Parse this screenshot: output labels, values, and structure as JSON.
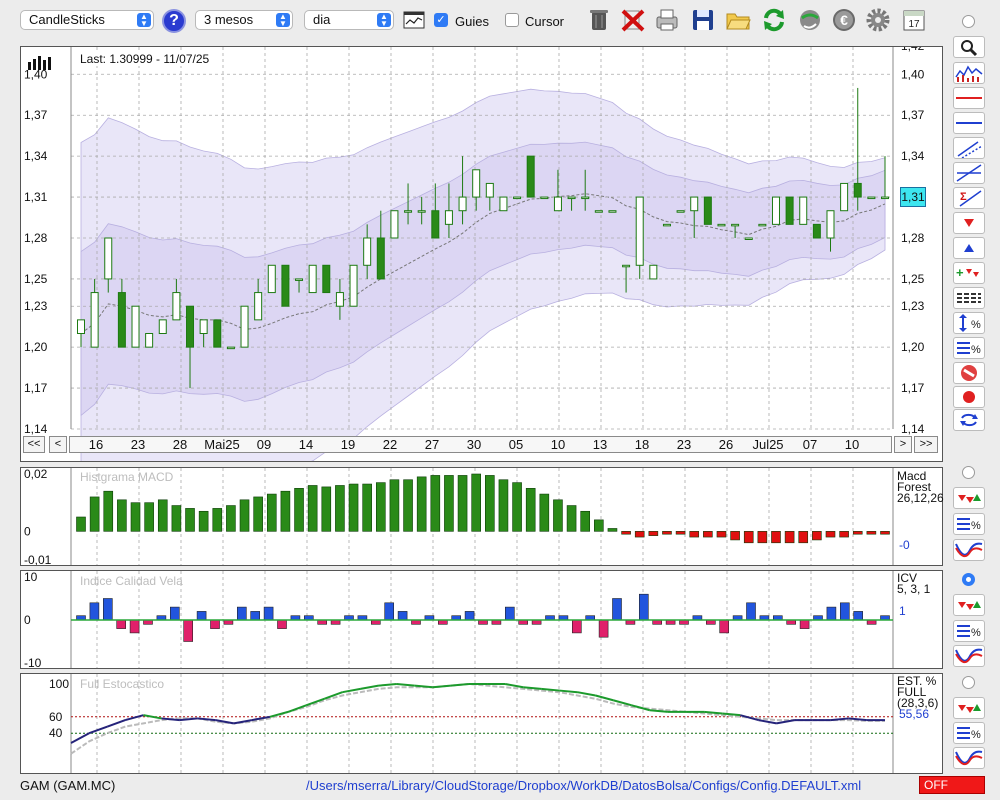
{
  "toolbar": {
    "chart_type": "CandleSticks",
    "help_label": "?",
    "period": "3 mesos",
    "interval": "dia",
    "guides_label": "Guies",
    "guides_checked": true,
    "cursor_label": "Cursor",
    "cursor_checked": false,
    "calendar_day": "17",
    "icons": [
      "trash-icon",
      "delete-icon",
      "print-icon",
      "save-icon",
      "open-folder-icon",
      "refresh-icon",
      "globe-icon",
      "euro-icon",
      "gear-icon",
      "calendar-icon"
    ]
  },
  "main_chart": {
    "last_label": "Last: 1.30999 - 11/07/25",
    "current_price_badge": "1,31",
    "y_ticks": [
      "1,40",
      "1,37",
      "1,34",
      "1,31",
      "1,28",
      "1,25",
      "1,23",
      "1,20",
      "1,17",
      "1,14"
    ],
    "y_top_partial": "1,42",
    "x_labels": [
      "16",
      "23",
      "28",
      "Mai25",
      "09",
      "14",
      "19",
      "22",
      "27",
      "30",
      "05",
      "10",
      "13",
      "18",
      "23",
      "26",
      "Jul25",
      "07",
      "10"
    ],
    "nav": {
      "first": "<<",
      "prev": "<",
      "next": ">",
      "last": ">>"
    }
  },
  "macd_panel": {
    "title": "Histgrama MACD",
    "name_line1": "Macd",
    "name_line2": "Forest",
    "params": "26,12,26",
    "value": "-0",
    "y_ticks": [
      "0,02",
      "0",
      "-0,01"
    ]
  },
  "icv_panel": {
    "title": "Indice Calidad Vela",
    "name": "ICV",
    "params": "5, 3, 1",
    "value": "1",
    "y_ticks": [
      "10",
      "0",
      "-10"
    ]
  },
  "stoch_panel": {
    "title": "Full Estocastico",
    "name_line1": "EST. %",
    "name_line2": "FULL",
    "params": "(28,3,6)",
    "value": "55,56",
    "y_ticks": [
      "100",
      "60",
      "40"
    ]
  },
  "status": {
    "ticker": "GAM (GAM.MC)",
    "path": "/Users/mserra/Library/CloudStorage/Dropbox/WorkDB/DatosBolsa/Configs/Config.DEFAULT.xml",
    "off_label": "OFF"
  },
  "chart_data": [
    {
      "type": "candlestick",
      "ylim": [
        1.14,
        1.42
      ],
      "candles": [
        {
          "o": 1.21,
          "h": 1.22,
          "l": 1.2,
          "c": 1.22
        },
        {
          "o": 1.2,
          "h": 1.25,
          "l": 1.2,
          "c": 1.24
        },
        {
          "o": 1.25,
          "h": 1.28,
          "l": 1.24,
          "c": 1.28
        },
        {
          "o": 1.24,
          "h": 1.25,
          "l": 1.2,
          "c": 1.2
        },
        {
          "o": 1.2,
          "h": 1.23,
          "l": 1.2,
          "c": 1.23
        },
        {
          "o": 1.2,
          "h": 1.21,
          "l": 1.2,
          "c": 1.21
        },
        {
          "o": 1.21,
          "h": 1.22,
          "l": 1.21,
          "c": 1.22
        },
        {
          "o": 1.22,
          "h": 1.25,
          "l": 1.22,
          "c": 1.24
        },
        {
          "o": 1.23,
          "h": 1.23,
          "l": 1.17,
          "c": 1.2
        },
        {
          "o": 1.21,
          "h": 1.22,
          "l": 1.2,
          "c": 1.22
        },
        {
          "o": 1.22,
          "h": 1.22,
          "l": 1.2,
          "c": 1.2
        },
        {
          "o": 1.2,
          "h": 1.2,
          "l": 1.2,
          "c": 1.2
        },
        {
          "o": 1.2,
          "h": 1.23,
          "l": 1.2,
          "c": 1.23
        },
        {
          "o": 1.22,
          "h": 1.25,
          "l": 1.22,
          "c": 1.24
        },
        {
          "o": 1.24,
          "h": 1.26,
          "l": 1.24,
          "c": 1.26
        },
        {
          "o": 1.26,
          "h": 1.26,
          "l": 1.23,
          "c": 1.23
        },
        {
          "o": 1.25,
          "h": 1.25,
          "l": 1.24,
          "c": 1.25
        },
        {
          "o": 1.24,
          "h": 1.26,
          "l": 1.24,
          "c": 1.26
        },
        {
          "o": 1.26,
          "h": 1.26,
          "l": 1.24,
          "c": 1.24
        },
        {
          "o": 1.23,
          "h": 1.25,
          "l": 1.22,
          "c": 1.24
        },
        {
          "o": 1.23,
          "h": 1.26,
          "l": 1.23,
          "c": 1.26
        },
        {
          "o": 1.26,
          "h": 1.29,
          "l": 1.25,
          "c": 1.28
        },
        {
          "o": 1.28,
          "h": 1.3,
          "l": 1.25,
          "c": 1.25
        },
        {
          "o": 1.28,
          "h": 1.3,
          "l": 1.28,
          "c": 1.3
        },
        {
          "o": 1.3,
          "h": 1.32,
          "l": 1.29,
          "c": 1.3
        },
        {
          "o": 1.3,
          "h": 1.31,
          "l": 1.29,
          "c": 1.3
        },
        {
          "o": 1.3,
          "h": 1.32,
          "l": 1.28,
          "c": 1.28
        },
        {
          "o": 1.29,
          "h": 1.32,
          "l": 1.28,
          "c": 1.3
        },
        {
          "o": 1.3,
          "h": 1.34,
          "l": 1.29,
          "c": 1.31
        },
        {
          "o": 1.31,
          "h": 1.33,
          "l": 1.3,
          "c": 1.33
        },
        {
          "o": 1.31,
          "h": 1.32,
          "l": 1.3,
          "c": 1.32
        },
        {
          "o": 1.3,
          "h": 1.31,
          "l": 1.3,
          "c": 1.31
        },
        {
          "o": 1.31,
          "h": 1.31,
          "l": 1.31,
          "c": 1.31
        },
        {
          "o": 1.34,
          "h": 1.34,
          "l": 1.31,
          "c": 1.31
        },
        {
          "o": 1.31,
          "h": 1.31,
          "l": 1.31,
          "c": 1.31
        },
        {
          "o": 1.3,
          "h": 1.33,
          "l": 1.3,
          "c": 1.31
        },
        {
          "o": 1.31,
          "h": 1.31,
          "l": 1.3,
          "c": 1.31
        },
        {
          "o": 1.31,
          "h": 1.33,
          "l": 1.3,
          "c": 1.31
        },
        {
          "o": 1.3,
          "h": 1.3,
          "l": 1.3,
          "c": 1.3
        },
        {
          "o": 1.3,
          "h": 1.3,
          "l": 1.3,
          "c": 1.3
        },
        {
          "o": 1.26,
          "h": 1.26,
          "l": 1.24,
          "c": 1.26
        },
        {
          "o": 1.26,
          "h": 1.31,
          "l": 1.25,
          "c": 1.31
        },
        {
          "o": 1.25,
          "h": 1.26,
          "l": 1.25,
          "c": 1.26
        },
        {
          "o": 1.29,
          "h": 1.29,
          "l": 1.29,
          "c": 1.29
        },
        {
          "o": 1.3,
          "h": 1.3,
          "l": 1.3,
          "c": 1.3
        },
        {
          "o": 1.3,
          "h": 1.31,
          "l": 1.28,
          "c": 1.31
        },
        {
          "o": 1.31,
          "h": 1.31,
          "l": 1.29,
          "c": 1.29
        },
        {
          "o": 1.29,
          "h": 1.29,
          "l": 1.29,
          "c": 1.29
        },
        {
          "o": 1.29,
          "h": 1.29,
          "l": 1.28,
          "c": 1.29
        },
        {
          "o": 1.28,
          "h": 1.28,
          "l": 1.28,
          "c": 1.28
        },
        {
          "o": 1.29,
          "h": 1.29,
          "l": 1.29,
          "c": 1.29
        },
        {
          "o": 1.29,
          "h": 1.31,
          "l": 1.29,
          "c": 1.31
        },
        {
          "o": 1.31,
          "h": 1.31,
          "l": 1.29,
          "c": 1.29
        },
        {
          "o": 1.29,
          "h": 1.31,
          "l": 1.29,
          "c": 1.31
        },
        {
          "o": 1.29,
          "h": 1.29,
          "l": 1.28,
          "c": 1.28
        },
        {
          "o": 1.28,
          "h": 1.3,
          "l": 1.27,
          "c": 1.3
        },
        {
          "o": 1.3,
          "h": 1.32,
          "l": 1.3,
          "c": 1.32
        },
        {
          "o": 1.32,
          "h": 1.39,
          "l": 1.3,
          "c": 1.31
        },
        {
          "o": 1.31,
          "h": 1.31,
          "l": 1.31,
          "c": 1.31
        },
        {
          "o": 1.31,
          "h": 1.34,
          "l": 1.31,
          "c": 1.31
        }
      ]
    },
    {
      "type": "bar",
      "name": "Histgrama MACD",
      "ylim": [
        -0.01,
        0.02
      ],
      "values": [
        0.005,
        0.012,
        0.014,
        0.011,
        0.01,
        0.01,
        0.011,
        0.009,
        0.008,
        0.007,
        0.008,
        0.009,
        0.011,
        0.012,
        0.013,
        0.014,
        0.015,
        0.016,
        0.0155,
        0.016,
        0.0165,
        0.0165,
        0.017,
        0.018,
        0.018,
        0.019,
        0.0195,
        0.0195,
        0.0195,
        0.02,
        0.0195,
        0.018,
        0.017,
        0.015,
        0.013,
        0.011,
        0.009,
        0.007,
        0.004,
        0.001,
        -0.001,
        -0.002,
        -0.0015,
        -0.001,
        -0.001,
        -0.002,
        -0.002,
        -0.002,
        -0.003,
        -0.004,
        -0.004,
        -0.004,
        -0.004,
        -0.004,
        -0.003,
        -0.002,
        -0.002,
        -0.001,
        -0.001,
        -0.001
      ]
    },
    {
      "type": "bar",
      "name": "Indice Calidad Vela",
      "ylim": [
        -10,
        10
      ],
      "values": [
        1,
        4,
        5,
        -2,
        -3,
        -1,
        1,
        3,
        -5,
        2,
        -2,
        -1,
        3,
        2,
        3,
        -2,
        1,
        1,
        -1,
        -1,
        1,
        1,
        -1,
        4,
        2,
        -1,
        1,
        -1,
        1,
        2,
        -1,
        -1,
        3,
        -1,
        -1,
        1,
        1,
        -3,
        1,
        -4,
        5,
        -1,
        6,
        -1,
        -1,
        -1,
        1,
        -1,
        -3,
        1,
        4,
        1,
        1,
        -1,
        -2,
        1,
        3,
        4,
        2,
        -1,
        1
      ],
      "baseline_line": 0
    },
    {
      "type": "line",
      "name": "Full Estocastico",
      "ylim": [
        0,
        100
      ],
      "reference_lines": [
        60,
        40
      ],
      "series": [
        {
          "values": [
            28,
            40,
            48,
            56,
            62,
            58,
            56,
            58,
            56,
            52,
            56,
            60,
            66,
            74,
            82,
            90,
            94,
            98,
            100,
            98,
            96,
            98,
            100,
            100,
            100,
            96,
            94,
            92,
            90,
            86,
            80,
            74,
            68,
            66,
            66,
            66,
            64,
            62,
            56,
            52,
            56,
            56,
            56,
            58,
            56,
            56
          ]
        },
        {
          "values": [
            15,
            30,
            40,
            48,
            52,
            56,
            58,
            58,
            54,
            52,
            54,
            58,
            66,
            72,
            80,
            86,
            90,
            94,
            96,
            96,
            96,
            98,
            100,
            98,
            96,
            94,
            92,
            90,
            86,
            82,
            76,
            72,
            70,
            68,
            66,
            64,
            62,
            60,
            58,
            56,
            56,
            56,
            56,
            56,
            55,
            55
          ]
        }
      ]
    }
  ]
}
